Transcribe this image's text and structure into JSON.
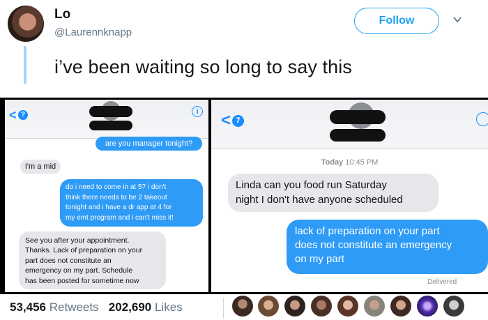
{
  "tweet": {
    "display_name": "Lo",
    "handle": "@Laurennknapp",
    "follow_label": "Follow",
    "text": "i’ve been waiting so long to say this"
  },
  "left_screenshot": {
    "badge": "?",
    "messages": [
      {
        "dir": "out",
        "text": "are you manager tonight?"
      },
      {
        "dir": "in",
        "text": "I'm a mid"
      },
      {
        "dir": "out",
        "lines": [
          "do i need to come in at 5? i don't",
          "think there needs to be 2 takeout",
          "tonight and i have a dr app at 4 for",
          "my emt program and i can't miss it!"
        ]
      },
      {
        "dir": "in",
        "lines": [
          "See you after your appointment.",
          "Thanks. Lack of preparation on your",
          "part does not constitute an",
          "emergency on my part. Schedule",
          "has been posted for sometime now"
        ]
      }
    ]
  },
  "right_screenshot": {
    "badge": "7",
    "timestamp_day": "Today",
    "timestamp_time": "10:45 PM",
    "messages": [
      {
        "dir": "in",
        "lines": [
          "Linda can you food run Saturday",
          "night I don't have anyone scheduled"
        ]
      },
      {
        "dir": "out",
        "lines": [
          "lack of preparation on your part",
          "does not constitute an emergency",
          "on my part"
        ]
      }
    ],
    "status": "Delivered"
  },
  "stats": {
    "retweets_count": "53,456",
    "retweets_label": "Retweets",
    "likes_count": "202,690",
    "likes_label": "Likes"
  },
  "colors": {
    "twitter_blue": "#1da1f2",
    "imessage_blue": "#2e9bf7",
    "received_gray": "#e6e6eb"
  }
}
